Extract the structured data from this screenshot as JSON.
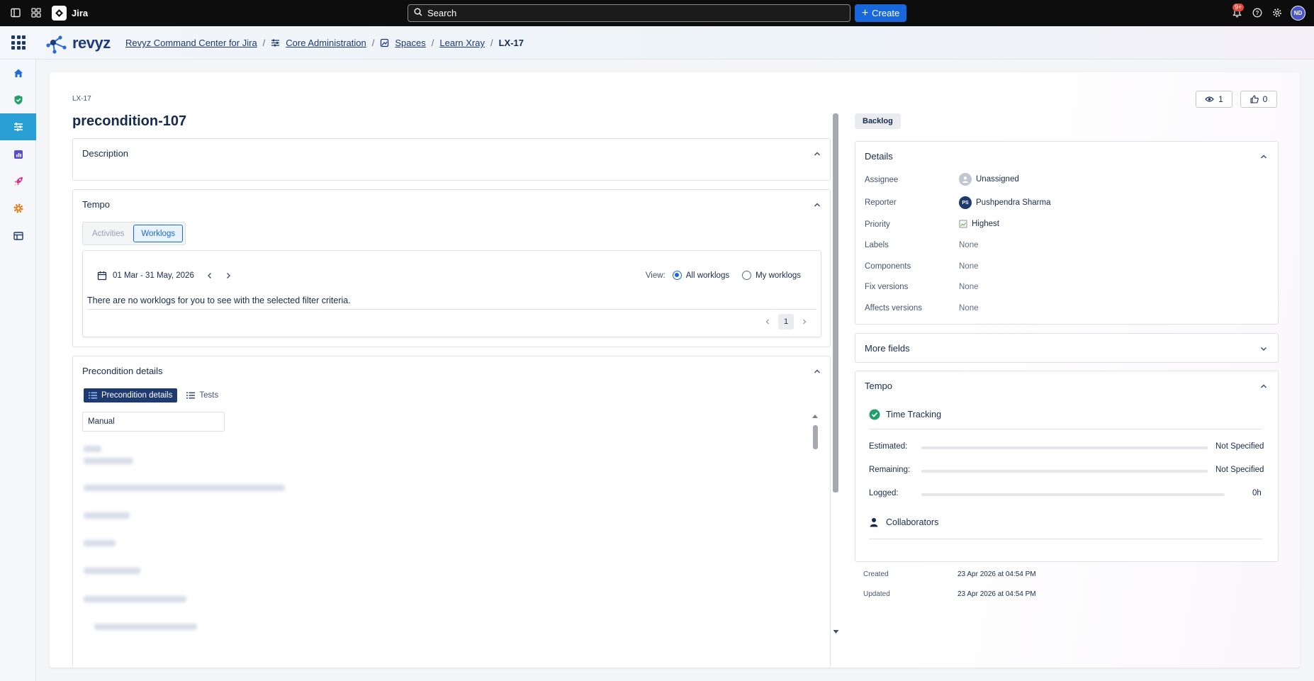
{
  "topbar": {
    "app_name": "Jira",
    "search_placeholder": "Search",
    "create_label": "Create",
    "notification_count": "9+",
    "user_initials": "ND"
  },
  "appbar": {
    "logo_text": "revyz",
    "breadcrumbs": [
      "Revyz Command Center for Jira",
      "Core Administration",
      "Spaces",
      "Learn Xray",
      "LX-17"
    ]
  },
  "issue": {
    "key": "LX-17",
    "title": "precondition-107",
    "watchers": "1",
    "votes": "0",
    "status": "Backlog"
  },
  "description": {
    "title": "Description"
  },
  "tempo": {
    "title": "Tempo",
    "tabs": [
      "Activities",
      "Worklogs"
    ],
    "selected_tab": "Worklogs",
    "date_range": "01 Mar - 31 May, 2026",
    "view_label": "View:",
    "view_options": [
      "All worklogs",
      "My worklogs"
    ],
    "selected_view": "All worklogs",
    "empty_message": "There are no worklogs for you to see with the selected filter criteria.",
    "page": "1"
  },
  "precondition": {
    "title": "Precondition details",
    "tabs": [
      "Precondition details",
      "Tests"
    ],
    "type_value": "Manual"
  },
  "details": {
    "title": "Details",
    "fields": [
      {
        "label": "Assignee",
        "value": "Unassigned"
      },
      {
        "label": "Reporter",
        "value": "Pushpendra Sharma",
        "initials": "PS"
      },
      {
        "label": "Priority",
        "value": "Highest"
      },
      {
        "label": "Labels",
        "value": "None"
      },
      {
        "label": "Components",
        "value": "None"
      },
      {
        "label": "Fix versions",
        "value": "None"
      },
      {
        "label": "Affects versions",
        "value": "None"
      }
    ]
  },
  "more_fields": {
    "title": "More fields"
  },
  "tempo_side": {
    "title": "Tempo",
    "time_tracking": "Time Tracking",
    "estimated_label": "Estimated:",
    "estimated_value": "Not Specified",
    "remaining_label": "Remaining:",
    "remaining_value": "Not Specified",
    "logged_label": "Logged:",
    "logged_value": "0h",
    "collaborators": "Collaborators"
  },
  "meta": {
    "created_label": "Created",
    "created_value": "23 Apr 2026 at 04:54 PM",
    "updated_label": "Updated",
    "updated_value": "23 Apr 2026 at 04:54 PM"
  },
  "colors": {
    "topbar": "#0d0d0d",
    "brand_blue": "#1868db",
    "nav_active": "#2a9fd6",
    "tab_navy": "#1f3a6e",
    "success_green": "#22a06b"
  }
}
